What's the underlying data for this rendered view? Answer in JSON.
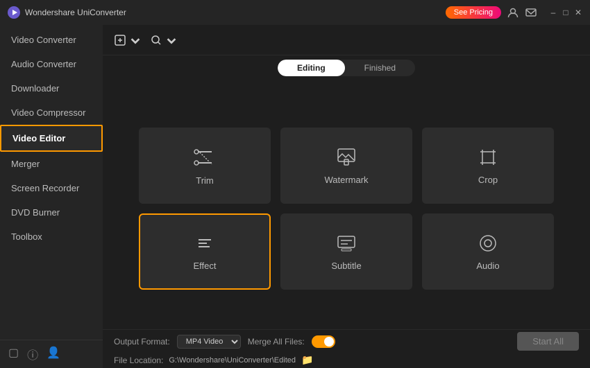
{
  "titlebar": {
    "app_name": "Wondershare UniConverter",
    "see_pricing_label": "See Pricing"
  },
  "sidebar": {
    "items": [
      {
        "id": "video-converter",
        "label": "Video Converter",
        "active": false
      },
      {
        "id": "audio-converter",
        "label": "Audio Converter",
        "active": false
      },
      {
        "id": "downloader",
        "label": "Downloader",
        "active": false
      },
      {
        "id": "video-compressor",
        "label": "Video Compressor",
        "active": false
      },
      {
        "id": "video-editor",
        "label": "Video Editor",
        "active": true
      },
      {
        "id": "merger",
        "label": "Merger",
        "active": false
      },
      {
        "id": "screen-recorder",
        "label": "Screen Recorder",
        "active": false
      },
      {
        "id": "dvd-burner",
        "label": "DVD Burner",
        "active": false
      },
      {
        "id": "toolbox",
        "label": "Toolbox",
        "active": false
      }
    ]
  },
  "tabs": {
    "editing_label": "Editing",
    "finished_label": "Finished"
  },
  "editor": {
    "cards": [
      {
        "id": "trim",
        "label": "Trim",
        "icon": "scissors",
        "highlighted": false
      },
      {
        "id": "watermark",
        "label": "Watermark",
        "icon": "watermark",
        "highlighted": false
      },
      {
        "id": "crop",
        "label": "Crop",
        "icon": "crop",
        "highlighted": false
      },
      {
        "id": "effect",
        "label": "Effect",
        "icon": "effect",
        "highlighted": true
      },
      {
        "id": "subtitle",
        "label": "Subtitle",
        "icon": "subtitle",
        "highlighted": false
      },
      {
        "id": "audio",
        "label": "Audio",
        "icon": "audio",
        "highlighted": false
      }
    ]
  },
  "footer": {
    "output_format_label": "Output Format:",
    "output_format_value": "MP4 Video",
    "merge_all_files_label": "Merge All Files:",
    "file_location_label": "File Location:",
    "file_path": "G:\\Wondershare\\UniConverter\\Edited",
    "start_btn_label": "Start All"
  }
}
